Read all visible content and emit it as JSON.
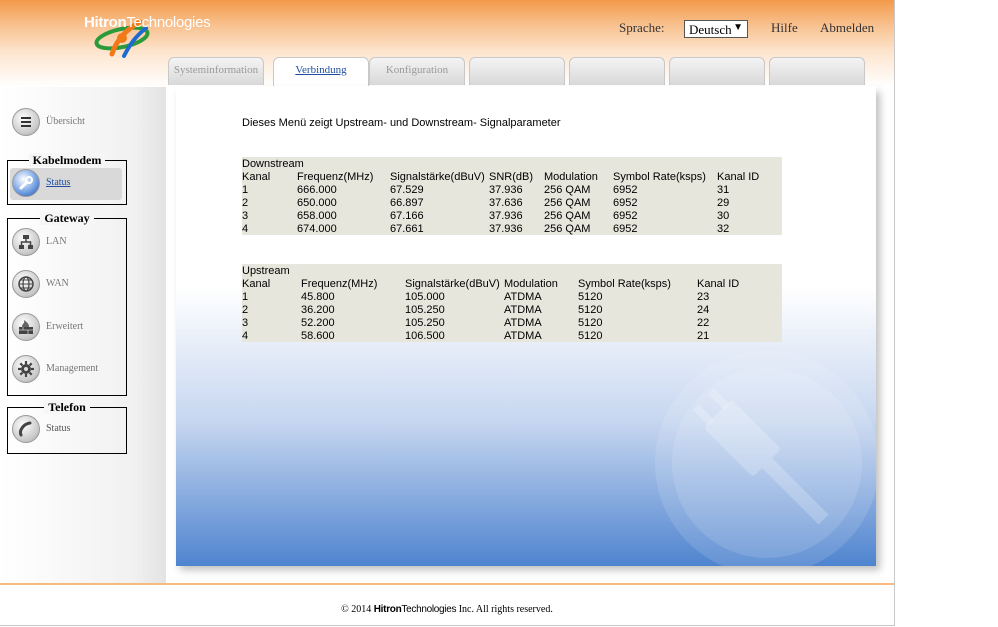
{
  "header": {
    "logo_text_bold": "Hitron",
    "logo_text_regular": "Technologies",
    "language_label": "Sprache:",
    "language_selected": "Deutsch",
    "help_link": "Hilfe",
    "logout_link": "Abmelden",
    "colors": {
      "header_orange": "#f39a4a",
      "accent_blue": "#1f4e9e"
    }
  },
  "tabs": [
    {
      "label": "Systeminformation",
      "active": false
    },
    {
      "label": "Verbindung",
      "active": true
    },
    {
      "label": "Konfiguration",
      "active": false
    },
    {
      "label": "",
      "active": false
    },
    {
      "label": "",
      "active": false
    },
    {
      "label": "",
      "active": false
    },
    {
      "label": "",
      "active": false
    }
  ],
  "sidebar": {
    "overview": {
      "label": "Übersicht",
      "icon": "list-icon"
    },
    "groups": [
      {
        "title": "Kabelmodem",
        "items": [
          {
            "label": "Status",
            "icon": "wrench-icon",
            "active": true
          }
        ]
      },
      {
        "title": "Gateway",
        "items": [
          {
            "label": "LAN",
            "icon": "network-icon",
            "active": false
          },
          {
            "label": "WAN",
            "icon": "globe-icon",
            "active": false
          },
          {
            "label": "Erweitert",
            "icon": "firewall-icon",
            "active": false
          },
          {
            "label": "Management",
            "icon": "gear-icon",
            "active": false
          }
        ]
      },
      {
        "title": "Telefon",
        "items": [
          {
            "label": "Status",
            "icon": "phone-icon",
            "active": false
          }
        ]
      }
    ]
  },
  "main": {
    "intro": "Dieses Menü zeigt Upstream- und Downstream- Signalparameter",
    "downstream": {
      "caption": "Downstream",
      "headers": [
        "Kanal",
        "Frequenz(MHz)",
        "Signalstärke(dBuV)",
        "SNR(dB)",
        "Modulation",
        "Symbol Rate(ksps)",
        "Kanal ID"
      ],
      "rows": [
        [
          "1",
          "666.000",
          "67.529",
          "37.936",
          "256 QAM",
          "6952",
          "31"
        ],
        [
          "2",
          "650.000",
          "66.897",
          "37.636",
          "256 QAM",
          "6952",
          "29"
        ],
        [
          "3",
          "658.000",
          "67.166",
          "37.936",
          "256 QAM",
          "6952",
          "30"
        ],
        [
          "4",
          "674.000",
          "67.661",
          "37.936",
          "256 QAM",
          "6952",
          "32"
        ]
      ]
    },
    "upstream": {
      "caption": "Upstream",
      "headers": [
        "Kanal",
        "Frequenz(MHz)",
        "Signalstärke(dBuV)",
        "Modulation",
        "Symbol Rate(ksps)",
        "Kanal ID"
      ],
      "rows": [
        [
          "1",
          "45.800",
          "105.000",
          "ATDMA",
          "5120",
          "23"
        ],
        [
          "2",
          "36.200",
          "105.250",
          "ATDMA",
          "5120",
          "24"
        ],
        [
          "3",
          "52.200",
          "105.250",
          "ATDMA",
          "5120",
          "22"
        ],
        [
          "4",
          "58.600",
          "106.500",
          "ATDMA",
          "5120",
          "21"
        ]
      ]
    }
  },
  "footer": {
    "prefix": "© 2014",
    "brand_bold": "Hitron",
    "brand_regular": "Technologies",
    "suffix": "Inc.  All rights reserved."
  }
}
